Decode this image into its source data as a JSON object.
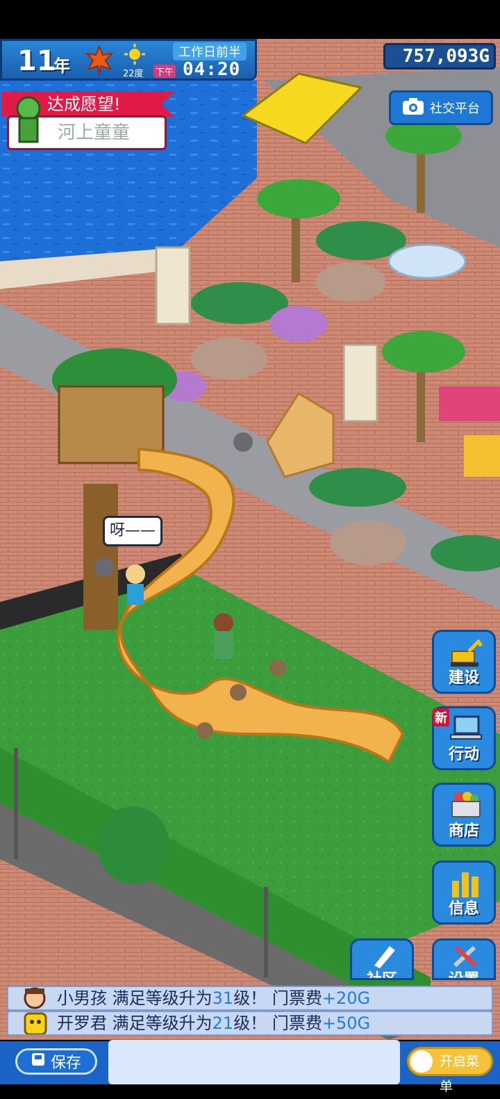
{
  "hud": {
    "year_number": "11",
    "year_unit": "年",
    "temperature": "22度",
    "day_period": "工作日前半",
    "ampm": "下午",
    "time": "04:20",
    "money": "757,093G",
    "social_label": "社交平台"
  },
  "wish": {
    "title": "达成愿望!",
    "name": "河上童童"
  },
  "speech": "呀——",
  "side_menu": {
    "build": "建设",
    "action": "行动",
    "action_badge": "新",
    "shop": "商店",
    "info": "信息",
    "community": "社区",
    "settings": "设置"
  },
  "tickers": [
    {
      "name": "小男孩",
      "text_a": "满足等级升为",
      "level": "31",
      "text_b": "级！ 门票费",
      "fee": "+20G"
    },
    {
      "name": "开罗君",
      "text_a": "满足等级升为",
      "level": "21",
      "text_b": "级！ 门票费",
      "fee": "+50G"
    }
  ],
  "bottom": {
    "save_label": "保存",
    "menu_label": "开启菜单"
  },
  "colors": {
    "hud_blue": "#2a86d8",
    "money_blue": "#1b4f92",
    "wish_red": "#e11947",
    "grass": "#3a9a3a",
    "brick": "#c9826a",
    "water": "#1e6fd8",
    "ladder": "#f2b24e"
  }
}
